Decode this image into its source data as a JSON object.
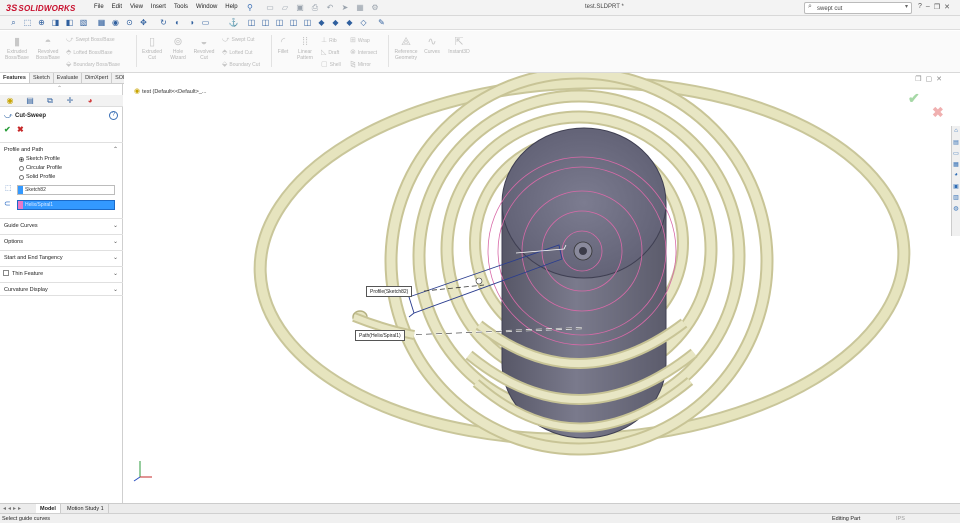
{
  "app": {
    "logo_text": "SOLIDWORKS",
    "logo_mark": "3S",
    "document_title": "test.SLDPRT *"
  },
  "menu": [
    "File",
    "Edit",
    "View",
    "Insert",
    "Tools",
    "Window",
    "Help"
  ],
  "search": {
    "value": "swept cut"
  },
  "commands": {
    "extruded_boss": "Extruded Boss/Base",
    "revolved_boss": "Revolved Boss/Base",
    "swept_boss": "Swept Boss/Base",
    "lofted_boss": "Lofted Boss/Base",
    "boundary_boss": "Boundary Boss/Base",
    "extruded_cut": "Extruded Cut",
    "hole_wizard": "Hole Wizard",
    "revolved_cut": "Revolved Cut",
    "swept_cut": "Swept Cut",
    "lofted_cut": "Lofted Cut",
    "boundary_cut": "Boundary Cut",
    "fillet": "Fillet",
    "linear_pattern": "Linear Pattern",
    "rib": "Rib",
    "draft": "Draft",
    "shell": "Shell",
    "wrap": "Wrap",
    "intersect": "Intersect",
    "mirror": "Mirror",
    "reference_geometry": "Reference Geometry",
    "curves": "Curves",
    "instant3d": "Instant3D"
  },
  "tabs": [
    "Features",
    "Sketch",
    "Evaluate",
    "DimXpert",
    "SOLIDWORKS Add-Ins"
  ],
  "property_manager": {
    "title": "Cut-Sweep",
    "sections": {
      "profile_and_path": "Profile and Path",
      "guide_curves": "Guide Curves",
      "options": "Options",
      "start_end_tangency": "Start and End Tangency",
      "thin_feature": "Thin Feature",
      "curvature_display": "Curvature Display"
    },
    "radio_options": [
      "Sketch Profile",
      "Circular Profile",
      "Solid Profile"
    ],
    "profile_value": "Sketch82",
    "path_value": "Helix/Spiral1"
  },
  "viewport": {
    "tree_flyout": "test (Default<<Default>_...",
    "callout_profile": "Profile(Sketch82)",
    "callout_path": "Path(Helix/Spiral1)"
  },
  "bottom_tabs": [
    "Model",
    "Motion Study 1"
  ],
  "status": {
    "message": "Select guide curves",
    "mode": "Editing Part",
    "units": "IPS"
  },
  "colors": {
    "spiral": "#e4e2b8",
    "cylinder": "#6c6c7e",
    "accent": "#3399ff",
    "brand": "#c8102e"
  }
}
